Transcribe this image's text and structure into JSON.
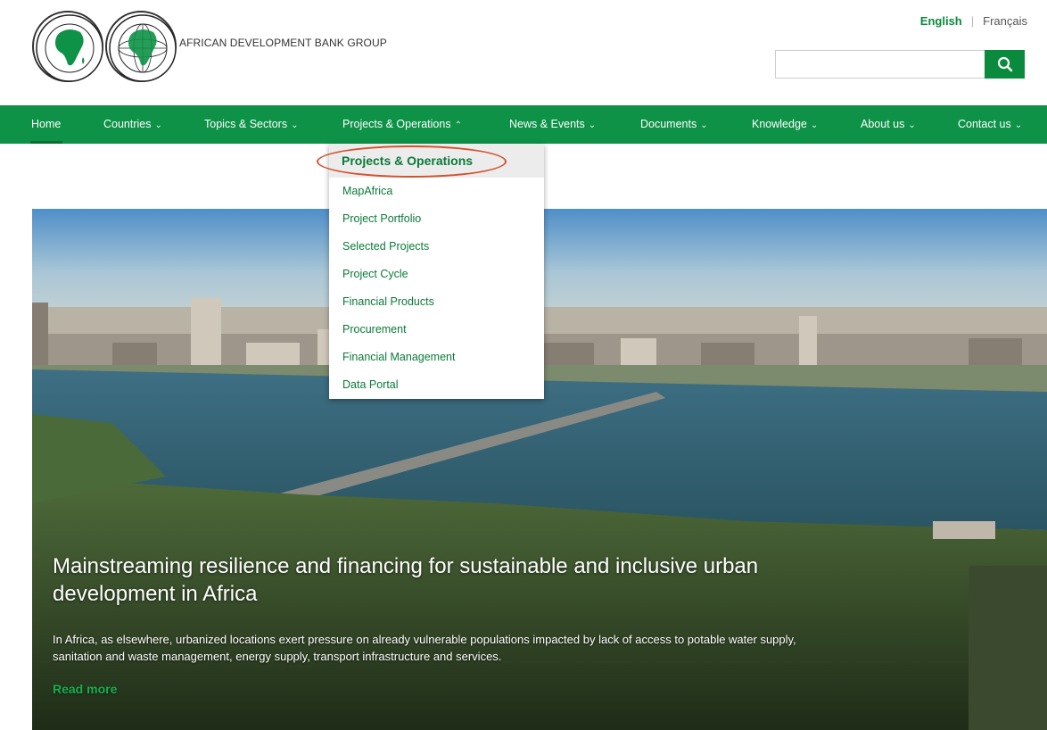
{
  "header": {
    "brand_name": "AFRICAN DEVELOPMENT BANK GROUP",
    "seal_1_text": "BANQUE AFRICAINE DE DEVELOPPEMENT · AFRICAN DEVELOPMENT BANK",
    "seal_2_text": "AFRICAN DEVELOPMENT FUND · FONDS AFRICAIN DE DEVELOPPEMENT",
    "languages": {
      "active": "English",
      "other": "Français"
    },
    "search": {
      "placeholder": "",
      "icon": "search-icon"
    }
  },
  "nav": {
    "items": [
      {
        "label": "Home",
        "has_chevron": false
      },
      {
        "label": "Countries",
        "has_chevron": true
      },
      {
        "label": "Topics & Sectors",
        "has_chevron": true
      },
      {
        "label": "Projects & Operations",
        "has_chevron": true,
        "open": true
      },
      {
        "label": "News & Events",
        "has_chevron": true
      },
      {
        "label": "Documents",
        "has_chevron": true
      },
      {
        "label": "Knowledge",
        "has_chevron": true
      },
      {
        "label": "About us",
        "has_chevron": true
      },
      {
        "label": "Contact us",
        "has_chevron": true
      }
    ]
  },
  "dropdown": {
    "heading": "Projects & Operations",
    "items": [
      "MapAfrica",
      "Project Portfolio",
      "Selected Projects",
      "Project Cycle",
      "Financial Products",
      "Procurement",
      "Financial Management",
      "Data Portal"
    ]
  },
  "hero": {
    "title": "Mainstreaming resilience and financing for sustainable and inclusive urban development in Africa",
    "description": "In Africa, as elsewhere, urbanized locations exert pressure on already vulnerable populations impacted by lack of access to potable water supply, sanitation and waste management, energy supply, transport infrastructure and services.",
    "cta": "Read more"
  },
  "colors": {
    "brand_green": "#0d9247",
    "link_green": "#0a7a38",
    "cta_green": "#16b04e",
    "active_underline": "#f0b12a",
    "annotation": "#d4502a"
  }
}
